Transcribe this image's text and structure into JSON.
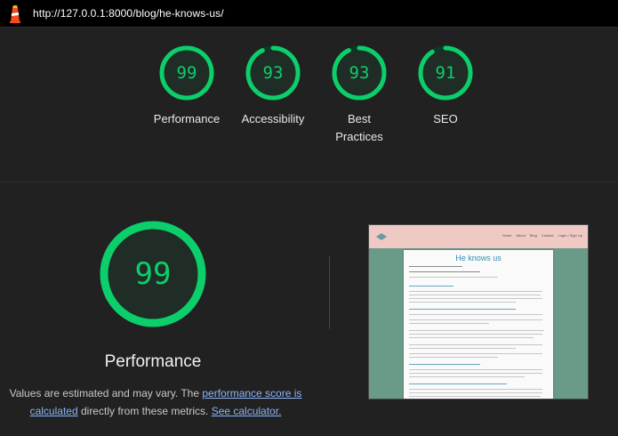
{
  "browser": {
    "url": "http://127.0.0.1:8000/blog/he-knows-us/",
    "logo_icon": "lighthouse-icon"
  },
  "summary_gauges": [
    {
      "label": "Performance",
      "score": "99",
      "fraction": 0.99
    },
    {
      "label": "Accessibility",
      "score": "93",
      "fraction": 0.93
    },
    {
      "label": "Best Practices",
      "score": "93",
      "fraction": 0.93
    },
    {
      "label": "SEO",
      "score": "91",
      "fraction": 0.91
    }
  ],
  "performance": {
    "score": "99",
    "fraction": 0.99,
    "title": "Performance",
    "desc_prefix": "Values are estimated and may vary. The ",
    "score_link": "performance score is calculated",
    "desc_middle": " directly from these metrics. ",
    "calc_link": "See calculator."
  },
  "thumbnail": {
    "nav_links": [
      "Home",
      "About",
      "Blog",
      "Contact",
      "Login / Sign Up"
    ],
    "post_title": "He knows us"
  },
  "colors": {
    "pass": "#0cce6b",
    "pass_track": "#0b3a23",
    "background": "#212121",
    "link": "#8ab4f8"
  }
}
